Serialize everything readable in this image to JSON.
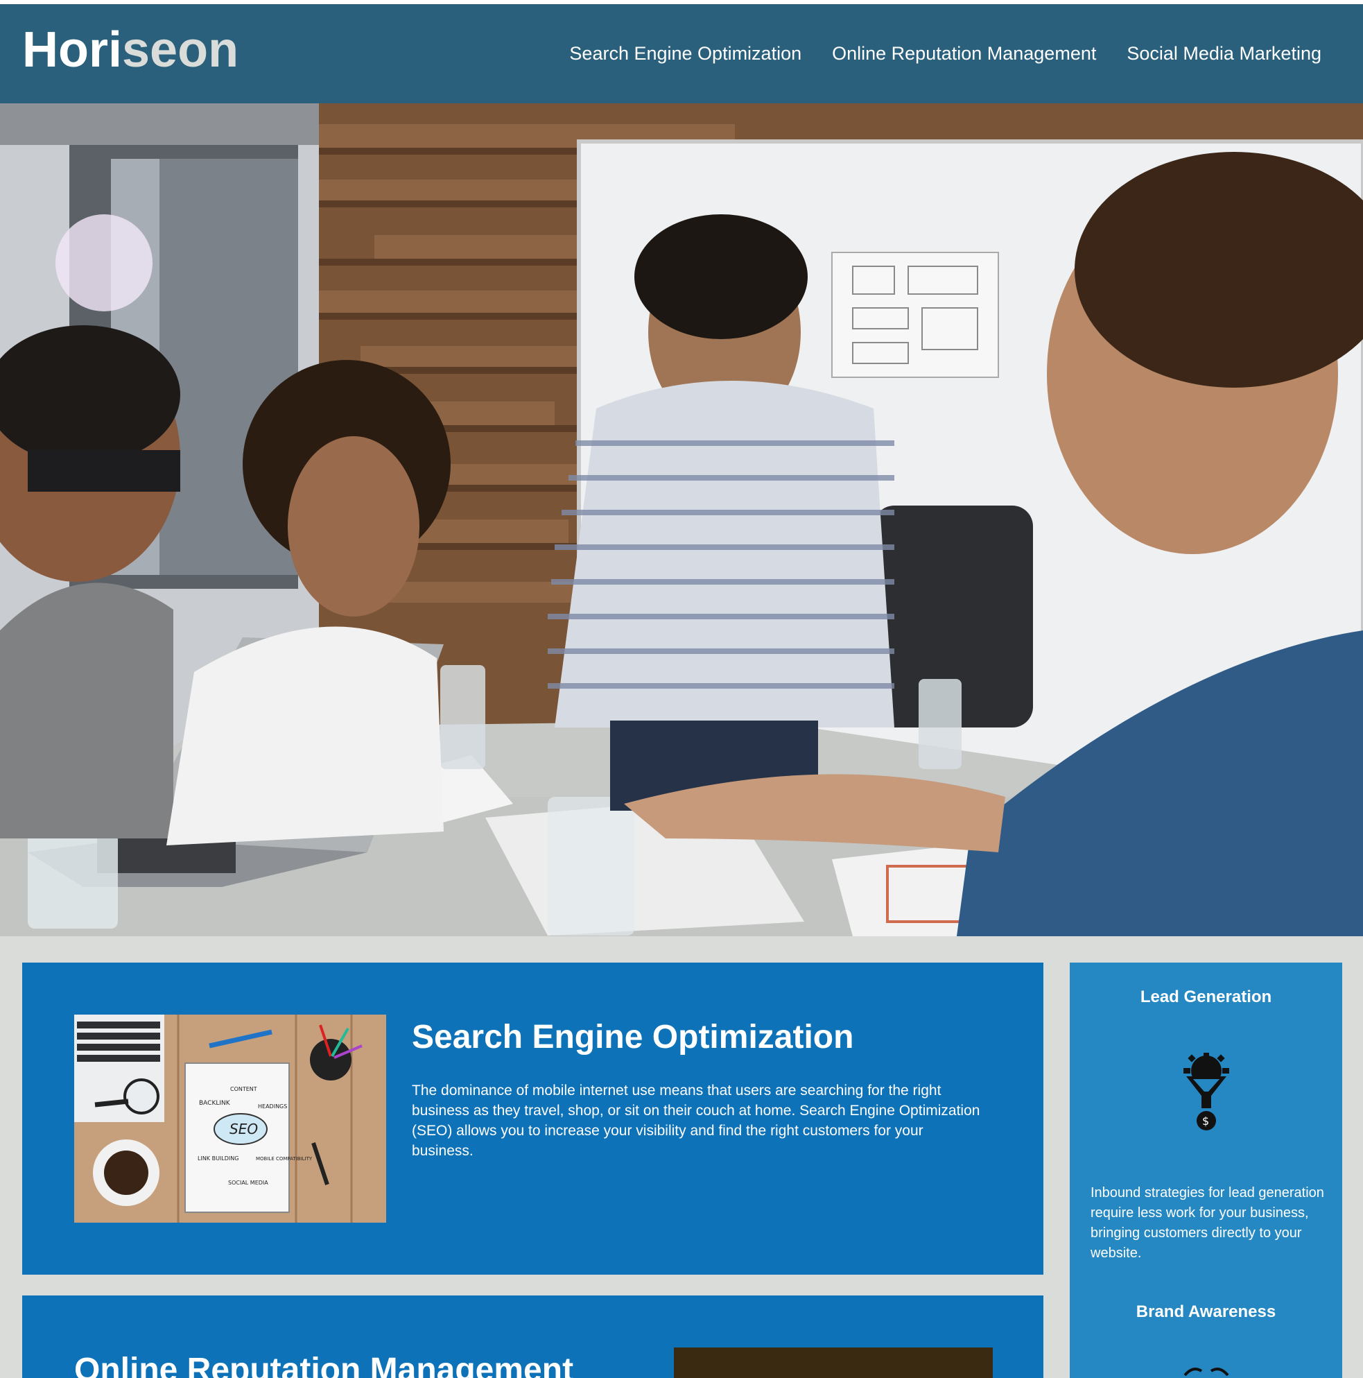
{
  "header": {
    "logo_part1": "Hori",
    "logo_part2": "seon",
    "nav": [
      {
        "label": "Search Engine Optimization"
      },
      {
        "label": "Online Reputation Management"
      },
      {
        "label": "Social Media Marketing"
      }
    ]
  },
  "hero": {
    "icon": "team-meeting-photo"
  },
  "main": {
    "cards": [
      {
        "title": "Search Engine Optimization",
        "body": "The dominance of mobile internet use means that users are searching for the right business as they travel, shop, or sit on their couch at home. Search Engine Optimization (SEO) allows you to increase your visibility and find the right customers for your business.",
        "image_labels": [
          "BACKLINK",
          "CONTENT",
          "HEADINGS",
          "SEO",
          "LINK BUILDING",
          "MOBILE COMPATIBILITY",
          "SOCIAL MEDIA"
        ]
      },
      {
        "title": "Online Reputation Management"
      }
    ]
  },
  "sidebar": {
    "items": [
      {
        "title": "Lead Generation",
        "icon": "lead-funnel-icon",
        "body": "Inbound strategies for lead generation require less work for your business, bringing customers directly to your website."
      },
      {
        "title": "Brand Awareness",
        "icon": "brand-awareness-icon"
      }
    ]
  },
  "colors": {
    "header_bg": "#2a607c",
    "card_bg": "#0e72b8",
    "sidebar_bg": "#2588c2",
    "page_bg": "#d9dcd9"
  }
}
